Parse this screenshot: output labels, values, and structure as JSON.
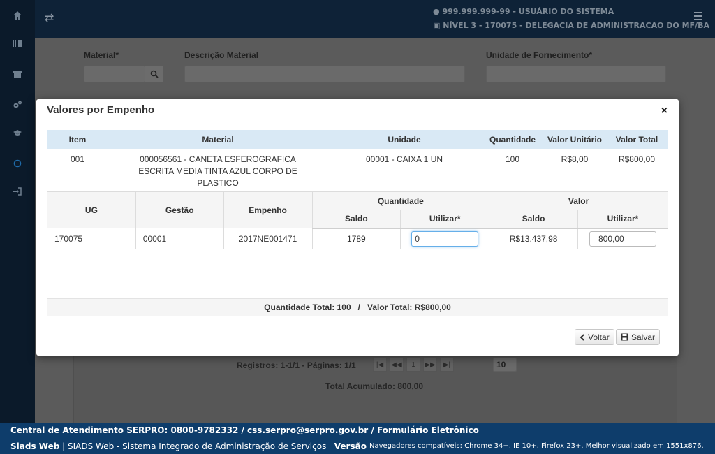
{
  "topbar": {
    "user": "999.999.999-99 - USUÁRIO DO SISTEMA",
    "level": "NÍVEL 3 - 170075 - DELEGACIA DE ADMINISTRACAO DO MF/BA"
  },
  "sidebar": {
    "icons": [
      "home-icon",
      "barcode-icon",
      "archive-icon",
      "cogs-icon",
      "graduation-cap-icon",
      "circle-icon",
      "sign-in-icon"
    ]
  },
  "background_form": {
    "material_label": "Material*",
    "descricao_label": "Descrição Material",
    "unidade_label": "Unidade de Fornecimento*",
    "registros": "Registros: 1-1/1 - Páginas: 1/1",
    "page_current": "1",
    "page_size": "10",
    "total_acumulado": "Total Acumulado: 800,00"
  },
  "modal": {
    "title": "Valores por Empenho",
    "close_symbol": "×",
    "item_table": {
      "headers": [
        "Item",
        "Material",
        "Unidade",
        "Quantidade",
        "Valor Unitário",
        "Valor Total"
      ],
      "row": {
        "item": "001",
        "material": "000056561 - CANETA ESFEROGRAFICA ESCRITA MEDIA TINTA AZUL CORPO DE PLASTICO",
        "unidade": "00001 - CAIXA 1 UN",
        "quantidade": "100",
        "valor_unitario": "R$8,00",
        "valor_total": "R$800,00"
      }
    },
    "empenho_table": {
      "headers": {
        "ug": "UG",
        "gestao": "Gestão",
        "empenho": "Empenho",
        "quantidade": "Quantidade",
        "valor": "Valor",
        "saldo": "Saldo",
        "utilizar": "Utilizar*"
      },
      "row": {
        "ug": "170075",
        "gestao": "00001",
        "empenho": "2017NE001471",
        "qtd_saldo": "1789",
        "qtd_utilizar": "0",
        "valor_saldo": "R$13.437,98",
        "valor_utilizar": "800,00"
      }
    },
    "totals": "Quantidade Total: 100   /   Valor Total: R$800,00",
    "buttons": {
      "voltar": "Voltar",
      "salvar": "Salvar"
    }
  },
  "footer": {
    "line1": "Central de Atendimento SERPRO: 0800-9782332 / css.serpro@serpro.gov.br / Formulário Eletrônico",
    "brand": "Siads Web",
    "separator": " | ",
    "system_name": "SIADS Web - Sistema Integrado de Administração de Serviços",
    "version_label": "Versão",
    "compat": "Navegadores compatíveis: Chrome 34+, IE 10+, Firefox 23+. Melhor visualizado em 1551x876."
  }
}
